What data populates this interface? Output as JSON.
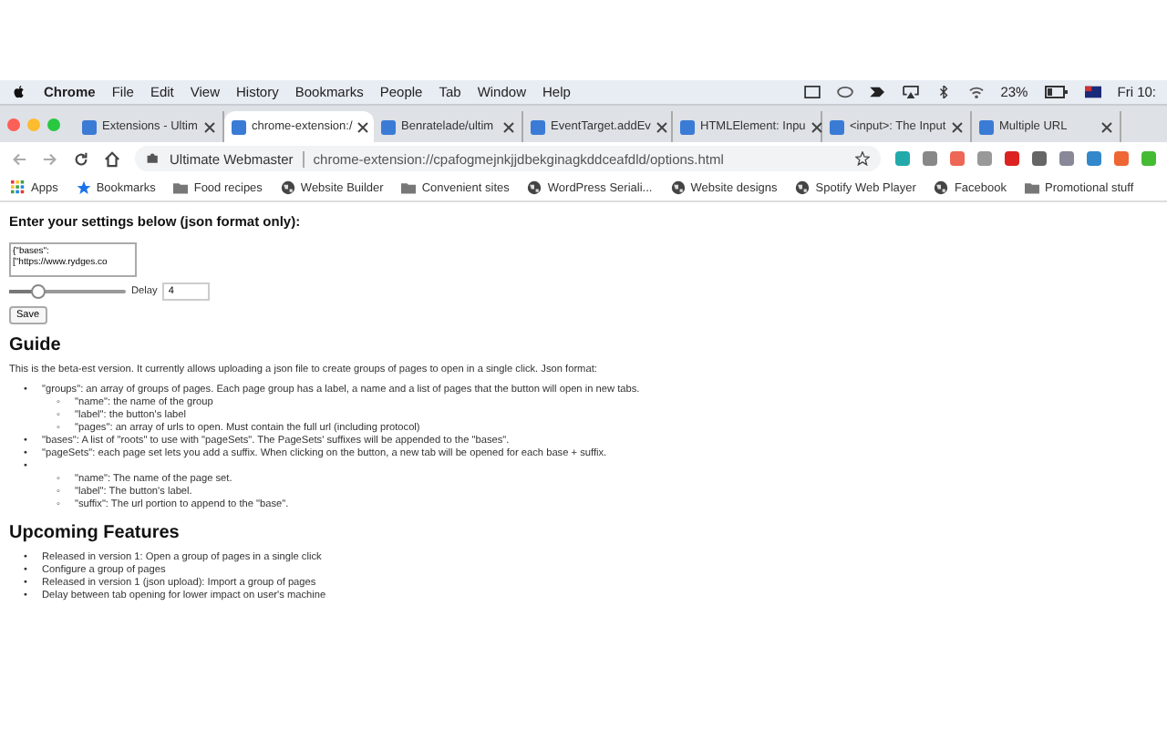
{
  "menu_bar": {
    "app": "Chrome",
    "items": [
      "File",
      "Edit",
      "View",
      "History",
      "Bookmarks",
      "People",
      "Tab",
      "Window",
      "Help"
    ],
    "battery": "23%",
    "clock": "Fri 10:"
  },
  "tabs": [
    {
      "label": "Extensions - Ultim",
      "selected": false
    },
    {
      "label": "chrome-extension:/",
      "selected": true
    },
    {
      "label": "Benratelade/ultim",
      "selected": false
    },
    {
      "label": "EventTarget.addEv",
      "selected": false
    },
    {
      "label": "HTMLElement: Inpu",
      "selected": false
    },
    {
      "label": "<input>: The Input",
      "selected": false
    },
    {
      "label": "Multiple URL",
      "selected": false
    }
  ],
  "address_bar": {
    "site": "Ultimate Webmaster",
    "url": "chrome-extension://cpafogmejnkjjdbekginagkddceafdld/options.html"
  },
  "bookmarks": [
    {
      "label": "Apps",
      "kind": "apps"
    },
    {
      "label": "Bookmarks",
      "kind": "star"
    },
    {
      "label": "Food recipes",
      "kind": "folder"
    },
    {
      "label": "Website Builder",
      "kind": "site"
    },
    {
      "label": "Convenient sites",
      "kind": "folder"
    },
    {
      "label": "WordPress Seriali...",
      "kind": "site"
    },
    {
      "label": "Website designs",
      "kind": "site"
    },
    {
      "label": "Spotify Web Player",
      "kind": "site"
    },
    {
      "label": "Facebook",
      "kind": "site"
    },
    {
      "label": "Promotional stuff",
      "kind": "folder"
    }
  ],
  "settings": {
    "heading": "Enter your settings below (json format only):",
    "textarea": "{\"bases\":\n[\"https://www.rydges.co",
    "slider": {
      "level": 0.25
    },
    "delay_label": "Delay",
    "delay_value": "4",
    "save": "Save"
  },
  "guide": {
    "title": "Guide",
    "intro": "This is the beta-est version. It currently allows uploading a json file to create groups of pages to open in a single click. Json format:",
    "items": [
      {
        "marker": "•",
        "text": "\"groups\": an array of groups of pages. Each page group has a label, a name and a list of pages that the button will open in new tabs.",
        "children": [
          {
            "marker": "◦",
            "text": "\"name\": the name of the group"
          },
          {
            "marker": "◦",
            "text": "\"label\": the button's label"
          },
          {
            "marker": "◦",
            "text": "\"pages\": an array of urls to open. Must contain the full url (including protocol)"
          }
        ]
      },
      {
        "marker": "•",
        "text": "\"bases\": A list of \"roots\" to use with \"pageSets\". The PageSets' suffixes will be appended to the \"bases\"."
      },
      {
        "marker": "•",
        "text": "\"pageSets\": each page set lets you add a suffix. When clicking on the button, a new tab will be opened for each base + suffix."
      },
      {
        "marker": "•",
        "children": [
          {
            "marker": "◦",
            "text": "\"name\": The name of the page set."
          },
          {
            "marker": "◦",
            "text": "\"label\": The button's label."
          },
          {
            "marker": "◦",
            "text": "\"suffix\": The url portion to append to the \"base\"."
          }
        ]
      }
    ]
  },
  "upcoming": {
    "title": "Upcoming Features",
    "items": [
      {
        "marker": "•",
        "text": "Released in version 1: Open a group of pages in a single click"
      },
      {
        "marker": "•",
        "text": "Configure a group of pages"
      },
      {
        "marker": "•",
        "text": "Released in version 1 (json upload): Import a group of pages"
      },
      {
        "marker": "•",
        "text": "Delay between tab opening for lower impact on user's machine"
      }
    ]
  }
}
